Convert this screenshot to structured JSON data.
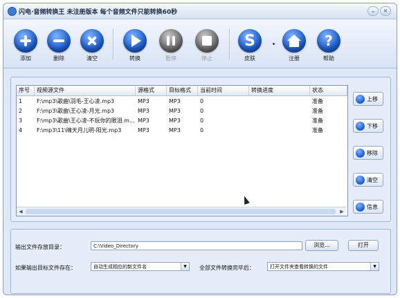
{
  "window": {
    "title": "闪电·音频转换王 未注册版本 每个音频文件只能转换60秒",
    "min": "⌄",
    "close": "×"
  },
  "toolbar": {
    "add": "添加",
    "delete": "删除",
    "clear": "清空",
    "convert": "转换",
    "pause": "暂停",
    "stop": "停止",
    "skin": "皮肤",
    "register": "注册",
    "help": "帮助"
  },
  "table": {
    "headers": [
      "序号",
      "视频源文件",
      "源格式",
      "目标格式",
      "当前时间",
      "转换进度",
      "状态"
    ],
    "rows": [
      {
        "no": "1",
        "file": "F:\\mp3\\歌曲\\羽毛-王心凌.mp3",
        "src": "MP3",
        "dst": "MP3",
        "time": "0",
        "progress": "",
        "status": "准备"
      },
      {
        "no": "2",
        "file": "F:\\mp3\\歌曲\\王心凌-月光.mp3",
        "src": "MP3",
        "dst": "MP3",
        "time": "0",
        "progress": "",
        "status": "准备"
      },
      {
        "no": "3",
        "file": "F:\\mp3\\歌曲\\王心凌-不玩你的眼泪.m...",
        "src": "MP3",
        "dst": "MP3",
        "time": "0",
        "progress": "",
        "status": "准备"
      },
      {
        "no": "4",
        "file": "F:\\mp3\\11\\晴天月儿明-阳光.mp3",
        "src": "MP3",
        "dst": "MP3",
        "time": "0",
        "progress": "",
        "status": "准备"
      }
    ]
  },
  "side": {
    "up": "上移",
    "down": "下移",
    "remove": "移除",
    "clear": "清空",
    "info": "信息"
  },
  "output": {
    "dir_label": "输出文件存放目录：",
    "dir_value": "C:\\Video_Directory",
    "browse": "浏览...",
    "open": "打开",
    "exists_label": "如果输出目标文件存在：",
    "exists_value": "自动生成相应的新文件名",
    "after_label": "全部文件转换完毕后：",
    "after_value": "打开文件夹查看转换的文件"
  }
}
